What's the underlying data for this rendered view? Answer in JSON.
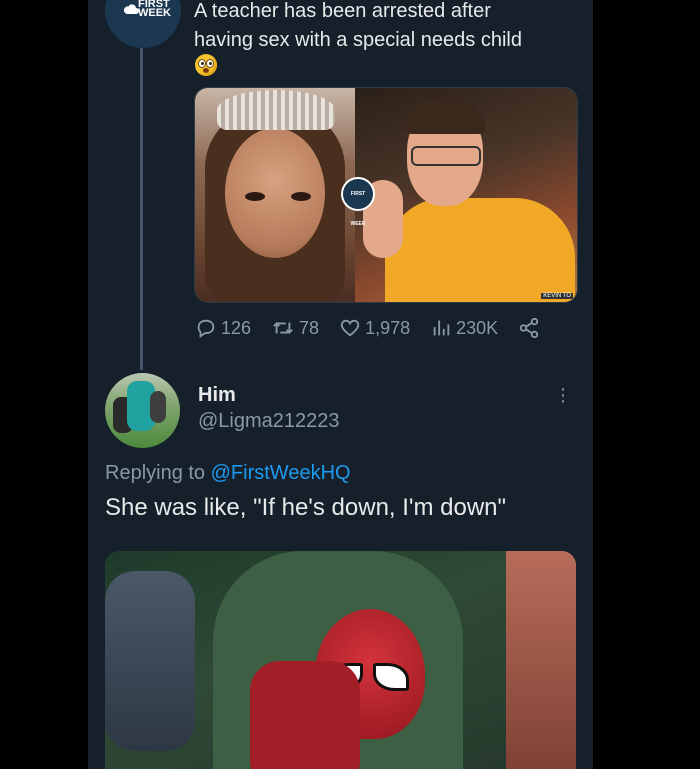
{
  "original_tweet": {
    "author_brand": "FIRST WEEK",
    "text_line1": "A teacher has been arrested after",
    "text_line2": "having sex with a special needs child",
    "emoji": "flushed-face",
    "image_badge": "FIRST WEEK",
    "photo_credit": "KEVIN TO",
    "stats": {
      "replies": "126",
      "retweets": "78",
      "likes": "1,978",
      "views": "230K"
    }
  },
  "reply": {
    "name": "Him",
    "handle": "@Ligma212223",
    "replying_prefix": "Replying to",
    "replying_to": "@FirstWeekHQ",
    "text": "She was like, \"If he's down, I'm down\""
  },
  "colors": {
    "background": "#15202b",
    "text": "#e7e9ea",
    "muted": "#8b98a5",
    "link": "#1d9bf0"
  }
}
